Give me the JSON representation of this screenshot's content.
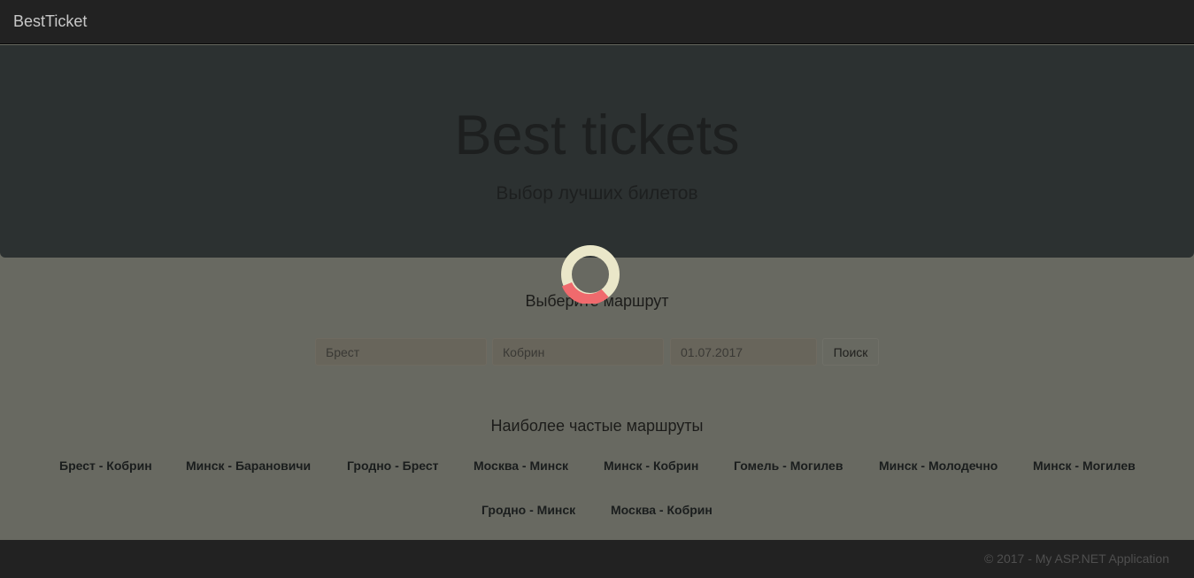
{
  "navbar": {
    "brand": "BestTicket"
  },
  "hero": {
    "title": "Best tickets",
    "subtitle": "Выбор лучших билетов"
  },
  "search": {
    "section_title": "Выберите маршрут",
    "from_value": "Брест",
    "to_value": "Кобрин",
    "date_value": "01.07.2017",
    "button_label": "Поиск"
  },
  "popular": {
    "title": "Наиболее частые маршруты",
    "routes": [
      "Брест - Кобрин",
      "Минск - Барановичи",
      "Гродно - Брест",
      "Москва - Минск",
      "Минск - Кобрин",
      "Гомель - Могилев",
      "Минск - Молодечно",
      "Минск - Могилев",
      "Гродно - Минск",
      "Москва - Кобрин"
    ]
  },
  "footer": {
    "text": "© 2017 - My ASP.NET Application"
  },
  "spinner": {
    "icon": "loading-spinner-icon",
    "ring_color": "#eae7c9",
    "arc_color": "#f06a6d"
  }
}
